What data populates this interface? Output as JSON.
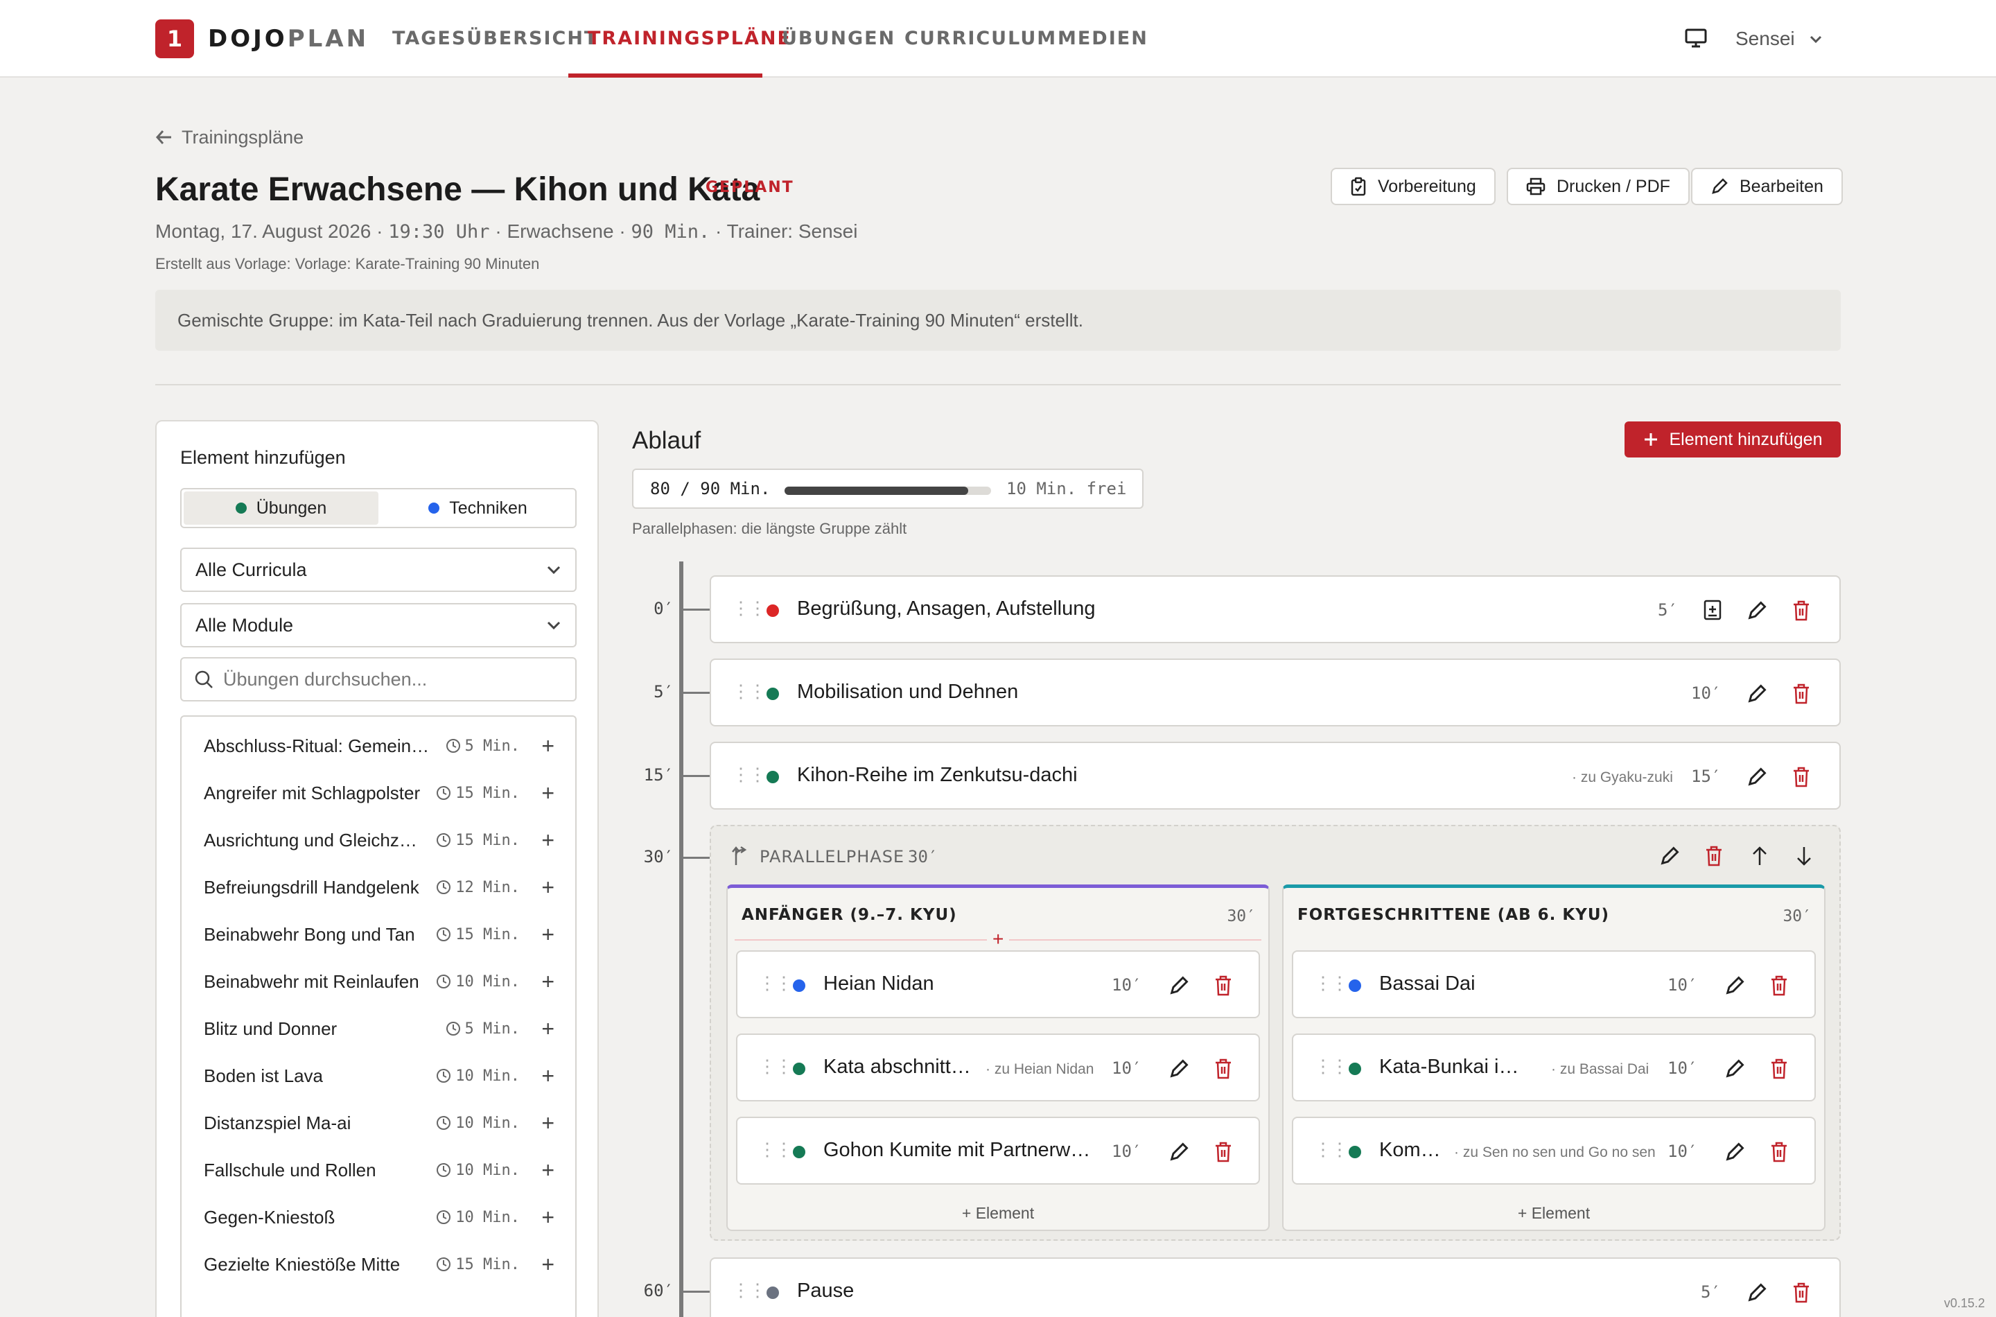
{
  "app": {
    "logo_glyph": "1",
    "brand_a": "DOJO",
    "brand_b": "PLAN",
    "version": "v0.15.2",
    "accent": "#c0232b"
  },
  "nav": {
    "items": [
      "TAGESÜBERSICHT",
      "TRAININGSPLÄNE",
      "ÜBUNGEN",
      "CURRICULUM",
      "MEDIEN"
    ],
    "active": "TRAININGSPLÄNE"
  },
  "user": {
    "name": "Sensei",
    "monitor_icon": "monitor-icon"
  },
  "header": {
    "back_label": "Trainingspläne",
    "title": "Karate Erwachsene — Kihon und Kata",
    "status": "GEPLANT",
    "date": "Montag, 17. August 2026",
    "time": "19:30 Uhr",
    "group": "Erwachsene",
    "duration": "90 Min.",
    "trainer": "Trainer: Sensei",
    "origin": "Erstellt aus Vorlage: Vorlage: Karate-Training 90 Minuten",
    "notes": "Gemischte Gruppe: im Kata-Teil nach Graduierung trennen. Aus der Vorlage „Karate-Training 90 Minuten“ erstellt.",
    "buttons": {
      "prep": "Vorbereitung",
      "print": "Drucken / PDF",
      "edit": "Bearbeiten"
    }
  },
  "sidebar": {
    "title": "Element hinzufügen",
    "tabs": [
      {
        "label": "Übungen",
        "color": "#157a55",
        "active": true
      },
      {
        "label": "Techniken",
        "color": "#2563eb",
        "active": false
      }
    ],
    "curriculum_select": "Alle Curricula",
    "module_select": "Alle Module",
    "search_placeholder": "Übungen durchsuchen...",
    "items": [
      {
        "name": "Abschluss-Ritual: Gemeinsames Abgrüßen",
        "duration": "5 Min."
      },
      {
        "name": "Angreifer mit Schlagpolster",
        "duration": "15 Min."
      },
      {
        "name": "Ausrichtung und Gleichzeitigkeit",
        "duration": "15 Min."
      },
      {
        "name": "Befreiungsdrill Handgelenk",
        "duration": "12 Min."
      },
      {
        "name": "Beinabwehr Bong und Tan",
        "duration": "15 Min."
      },
      {
        "name": "Beinabwehr mit Reinlaufen",
        "duration": "10 Min."
      },
      {
        "name": "Blitz und Donner",
        "duration": "5 Min."
      },
      {
        "name": "Boden ist Lava",
        "duration": "10 Min."
      },
      {
        "name": "Distanzspiel Ma-ai",
        "duration": "10 Min."
      },
      {
        "name": "Fallschule und Rollen",
        "duration": "10 Min."
      },
      {
        "name": "Gegen-Kniestoß",
        "duration": "10 Min."
      },
      {
        "name": "Gezielte Kniestöße Mitte",
        "duration": "15 Min."
      }
    ]
  },
  "plan": {
    "title": "Ablauf",
    "add_label": "Element hinzufügen",
    "budget_text": "80 / 90 Min.",
    "used": 80,
    "total": 90,
    "free_text": "10 Min. frei",
    "hint": "Parallelphasen: die längste Gruppe zählt",
    "timeline_labels": [
      "0′",
      "5′",
      "15′",
      "30′",
      "60′"
    ],
    "blocks": [
      {
        "name": "Begrüßung, Ansagen, Aufstellung",
        "duration": "5′",
        "color": "#dc2626"
      },
      {
        "name": "Mobilisation und Dehnen",
        "duration": "10′",
        "color": "#157a55"
      },
      {
        "name": "Kihon-Reihe im Zenkutsu-dachi",
        "duration": "15′",
        "color": "#157a55",
        "note": "· zu Gyaku-zuki"
      }
    ],
    "parallel": {
      "label": "PARALLELPHASE",
      "duration": "30′",
      "groups": [
        {
          "title": "ANFÄNGER (9.–7. KYU)",
          "duration": "30′",
          "accent": "#7c5cd6",
          "items": [
            {
              "name": "Heian Nidan",
              "duration": "10′",
              "color": "#2563eb"
            },
            {
              "name": "Kata abschnittsweise",
              "duration": "10′",
              "color": "#157a55",
              "note": "· zu Heian Nidan"
            },
            {
              "name": "Gohon Kumite mit Partnerwechsel",
              "duration": "10′",
              "color": "#157a55"
            }
          ],
          "add_label": "Element"
        },
        {
          "title": "FORTGESCHRITTENE (AB 6. KYU)",
          "duration": "30′",
          "accent": "#1a9aa8",
          "items": [
            {
              "name": "Bassai Dai",
              "duration": "10′",
              "color": "#2563eb"
            },
            {
              "name": "Kata-Bunkai in Paaren",
              "duration": "10′",
              "color": "#157a55",
              "note": "· zu Bassai Dai"
            },
            {
              "name": "Kombinationen",
              "duration": "10′",
              "color": "#157a55",
              "note": "· zu Sen no sen und Go no sen"
            }
          ],
          "add_label": "Element"
        }
      ]
    },
    "after": [
      {
        "name": "Pause",
        "duration": "5′",
        "color": "#6b7280"
      }
    ]
  }
}
